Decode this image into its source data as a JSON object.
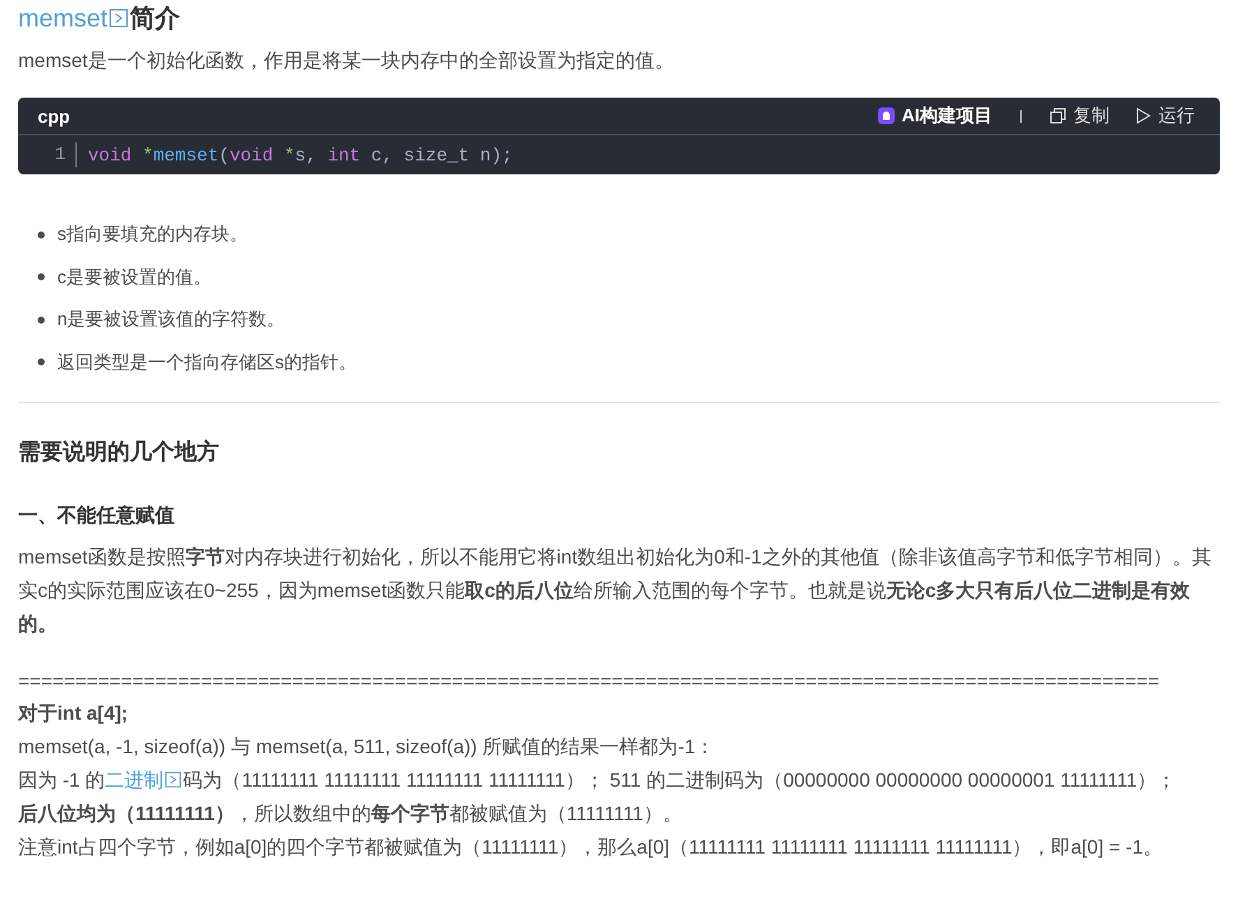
{
  "title": {
    "link": "memset",
    "text": "简介"
  },
  "intro": "memset是一个初始化函数，作用是将某一块内存中的全部设置为指定的值。",
  "code_block": {
    "language": "cpp",
    "actions": [
      {
        "kind": "ai",
        "label": "AI构建项目"
      },
      {
        "kind": "copy",
        "label": "复制"
      },
      {
        "kind": "run",
        "label": "运行"
      }
    ],
    "lines": [
      {
        "number": "1",
        "tokens": [
          {
            "kind": "keyword",
            "text": "void"
          },
          {
            "kind": "operator",
            "text": " *"
          },
          {
            "kind": "function",
            "text": "memset"
          },
          {
            "kind": "plain",
            "text": "("
          },
          {
            "kind": "keyword",
            "text": "void"
          },
          {
            "kind": "operator",
            "text": " *"
          },
          {
            "kind": "plain",
            "text": "s, "
          },
          {
            "kind": "keyword",
            "text": "int"
          },
          {
            "kind": "plain",
            "text": " c, size_t n);"
          }
        ]
      }
    ]
  },
  "bullets": [
    "s指向要填充的内存块。",
    "c是要被设置的值。",
    "n是要被设置该值的字符数。",
    "返回类型是一个指向存储区s的指针。"
  ],
  "section_heading": "需要说明的几个地方",
  "subheading": "一、不能任意赋值",
  "paragraph": "memset函数是按照**字节**对内存块进行初始化，所以不能用它将int数组出初始化为0和-1之外的其他值（除非该值高字节和低字节相同）。其实c的实际范围应该在0~255，因为memset函数只能**取c的后八位**给所输入范围的每个字节。也就是说**无论c多大只有后八位二进制是有效的。**",
  "separator": "====================================================================================================",
  "lines": [
    {
      "kind": "text",
      "text": "**对于int a[4];**"
    },
    {
      "kind": "text",
      "text": "memset(a, -1, sizeof(a)) 与 memset(a, 511, sizeof(a)) 所赋值的结果一样都为-1："
    },
    {
      "kind": "link",
      "before": "因为 -1 的",
      "link": "二进制",
      "after": "码为（11111111 11111111 11111111 11111111）； 511 的二进制码为（00000000 00000000 00000001 11111111）；"
    },
    {
      "kind": "text",
      "text": "**后八位均为（11111111）**，所以数组中的**每个字节**都被赋值为（11111111）。"
    },
    {
      "kind": "text",
      "text": "注意int占四个字节，例如a[0]的四个字节都被赋值为（11111111），那么a[0]（11111111 11111111 11111111 11111111），即a[0] = -1。"
    }
  ]
}
